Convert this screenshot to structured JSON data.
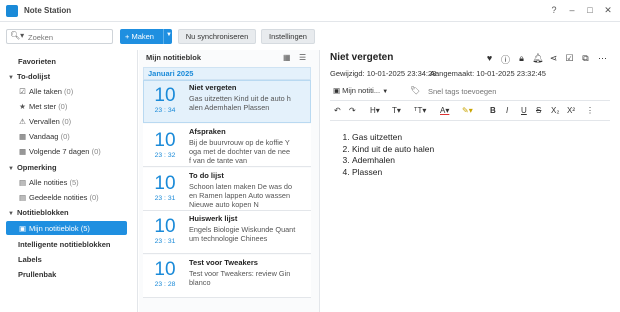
{
  "app": {
    "title": "Note Station"
  },
  "window_controls": {
    "help": "?",
    "minimize": "–",
    "maximize": "□",
    "close": "✕"
  },
  "toolbar": {
    "search_placeholder": "Zoeken",
    "new_label": "+ Maken",
    "sync_label": "Nu synchroniseren",
    "settings_label": "Instellingen"
  },
  "sidebar": {
    "favorites": "Favorieten",
    "todo": {
      "label": "To-dolijst",
      "items": [
        {
          "label": "Alle taken",
          "count": "(0)",
          "icon": "checkbox-icon"
        },
        {
          "label": "Met ster",
          "count": "(0)",
          "icon": "star-icon"
        },
        {
          "label": "Vervallen",
          "count": "(0)",
          "icon": "warning-icon"
        },
        {
          "label": "Vandaag",
          "count": "(0)",
          "icon": "calendar-icon"
        },
        {
          "label": "Volgende 7 dagen",
          "count": "(0)",
          "icon": "calendar-icon"
        }
      ]
    },
    "shortcuts": {
      "label": "Opmerking",
      "items": [
        {
          "label": "Alle notities",
          "count": "(5)"
        },
        {
          "label": "Gedeelde notities",
          "count": "(0)"
        }
      ]
    },
    "notebooks": {
      "label": "Notitieblokken",
      "items": [
        {
          "label": "Mijn notitieblok",
          "count": "(5)"
        }
      ]
    },
    "smart": "Intelligente notitieblokken",
    "labels": "Labels",
    "trash": "Prullenbak"
  },
  "list": {
    "title": "Mijn notitieblok",
    "month": "Januari 2025",
    "notes": [
      {
        "day": "10",
        "time": "23 : 34",
        "title": "Niet vergeten",
        "preview": "Gas uitzetten Kind uit de auto h\nalen Ademhalen Plassen"
      },
      {
        "day": "10",
        "time": "23 : 32",
        "title": "Afspraken",
        "preview": "Bij de buurvrouw op de koffie Y\noga met de dochter van de nee\nf van de tante van"
      },
      {
        "day": "10",
        "time": "23 : 31",
        "title": "To do lijst",
        "preview": "Schoon laten maken De was do\nen Ramen lappen Auto wassen\nNieuwe auto kopen N"
      },
      {
        "day": "10",
        "time": "23 : 31",
        "title": "Huiswerk lijst",
        "preview": "Engels Biologie Wiskunde Quant\num technologie Chinees"
      },
      {
        "day": "10",
        "time": "23 : 28",
        "title": "Test voor Tweakers",
        "preview": "Test voor Tweakers: review Gin\nblanco"
      }
    ]
  },
  "editor": {
    "title": "Niet vergeten",
    "modified_label": "Gewijzigd:",
    "modified": "10-01-2025 23:34:28",
    "created_label": "Aangemaakt:",
    "created": "10-01-2025 23:32:45",
    "notebook": "Mijn notiti...",
    "tag_placeholder": "Snel tags toevoegen",
    "content": [
      "Gas uitzetten",
      "Kind uit de auto halen",
      "Ademhalen",
      "Plassen"
    ]
  },
  "colors": {
    "accent": "#1f8fe0",
    "selected_bg": "#e4f1fb"
  }
}
